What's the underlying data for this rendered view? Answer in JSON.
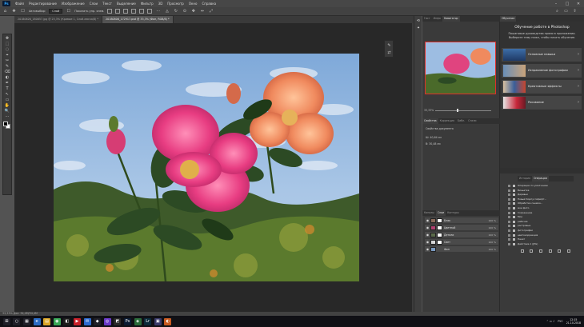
{
  "app": {
    "logo": "Ps"
  },
  "menu": [
    "Файл",
    "Редактирование",
    "Изображение",
    "Слои",
    "Текст",
    "Выделение",
    "Фильтр",
    "3D",
    "Просмотр",
    "Окно",
    "Справка"
  ],
  "window_controls": [
    "–",
    "□",
    "✕"
  ],
  "options_bar": {
    "autoselect_label": "Автовыбор:",
    "autoselect_value": "Слой",
    "transform_label": "Показать упр. элем."
  },
  "tabs": [
    {
      "label": "20180626_180657.jpg @ 25,3% (Кривые 1, Слой-маска/8) *",
      "active": false
    },
    {
      "label": "20180806_172917.psd @ 33,3% (Фон, RGB/8) *",
      "active": true
    }
  ],
  "tools": [
    "✥",
    "⬚",
    "◌",
    "⌖",
    "✂",
    "✎",
    "⌫",
    "◐",
    "✒",
    "T",
    "↖",
    "▭",
    "✋",
    "🔍",
    "⋯"
  ],
  "top_panel_tabs": [
    "Гист",
    "Инфо",
    "Навигатор"
  ],
  "zoom": "33,33%",
  "props_tabs": [
    "Свойства",
    "Коррекция",
    "Библ.",
    "Стили"
  ],
  "props_lines": [
    "Свойства документа",
    "Ш: 40,64 см",
    "В: 30,48 см"
  ],
  "layers_tabs": [
    "Каналы",
    "Слои",
    "Контуры"
  ],
  "layers": [
    {
      "name": "Блик",
      "opacity": "100 %"
    },
    {
      "name": "Цветной",
      "opacity": "100 %"
    },
    {
      "name": "Детали",
      "opacity": "100 %"
    },
    {
      "name": "Свет",
      "opacity": "100 %"
    },
    {
      "name": "Фон",
      "opacity": "100 %"
    }
  ],
  "learn": {
    "tab": "Обучение",
    "title": "Обучение работе в Photoshop",
    "desc": "Пошаговые руководства прямо в приложении. Выберите тему ниже, чтобы начать обучение.",
    "cards": [
      "Основные навыки",
      "Исправление фотографии",
      "Креативные эффекты",
      "Рисование"
    ]
  },
  "paths": {
    "tabs": [
      "История",
      "Операции"
    ],
    "items": [
      "Операции по умолчанию",
      "Виньетка",
      "Деревья",
      "Новый Корпус  Шрифт...",
      "Обработка съемки...",
      "мои фото",
      "Сохранение",
      "Мои",
      "рабочие",
      "растровые",
      "фотографии",
      "цветокоррекция",
      "Пакет",
      "Действие 1 (JPG)"
    ]
  },
  "status": "33,33%   Док: 34,4M/34,4M",
  "taskbar": {
    "icons": [
      "⊞",
      "○",
      "▦",
      "e",
      "▤",
      "◉",
      "◧",
      "▶",
      "✉",
      "◆",
      "◎",
      "◩",
      "Ps",
      "◈",
      "Lr",
      "▣",
      "◐"
    ],
    "tray": "РУС",
    "time": "12:15",
    "date": "21.10.2018"
  },
  "colors": {
    "accent": "#31a8ff",
    "nav_frame": "#e0302a"
  }
}
